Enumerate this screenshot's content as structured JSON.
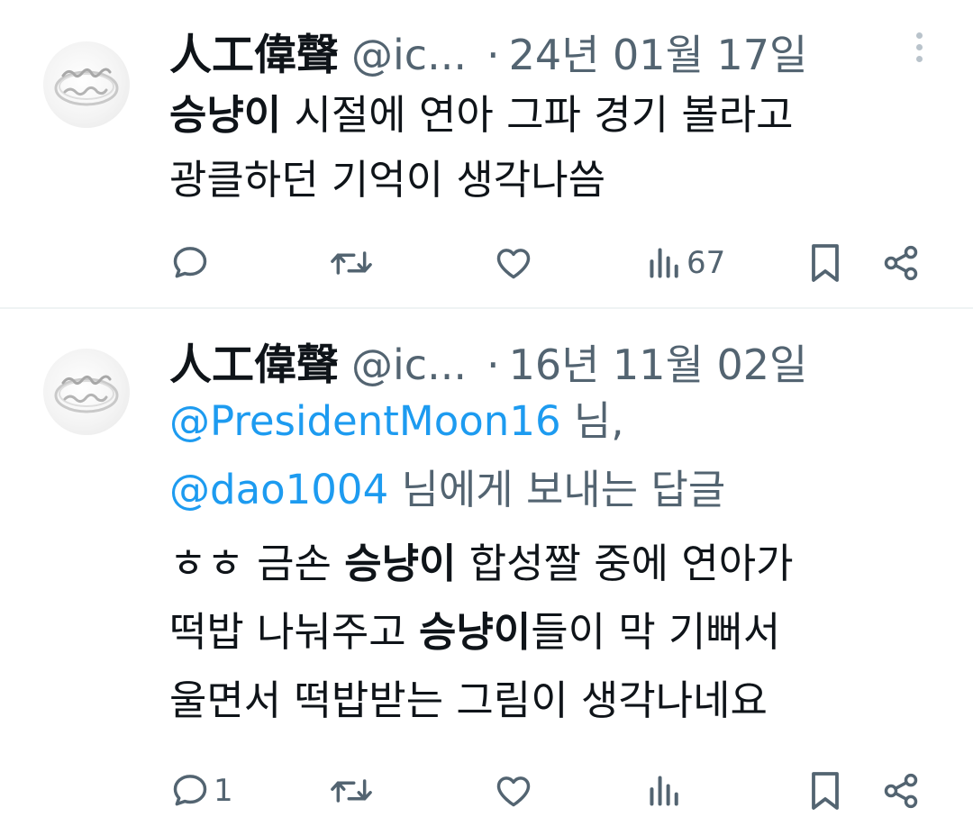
{
  "tweets": [
    {
      "author": {
        "name": "人工偉聲",
        "handle": "@ic..."
      },
      "separator": "·",
      "date": "24년 01월 17일",
      "text": {
        "bold_1": "승냥이",
        "line_1_rest": " 시절에 연아 그파 경기 볼라고",
        "line_2": "광클하던 기억이 생각나씀"
      },
      "actions": {
        "reply_icon": "comment-icon",
        "retweet_icon": "retweet-icon",
        "like_icon": "heart-icon",
        "views_icon": "bar-chart-icon",
        "views_count": "67",
        "bookmark_icon": "bookmark-icon",
        "share_icon": "share-icon"
      }
    },
    {
      "author": {
        "name": "人工偉聲",
        "handle": "@ic..."
      },
      "separator": "·",
      "date": "16년 11월 02일",
      "reply_to": {
        "mention_1": "@PresidentMoon16",
        "suffix_1": " 님,",
        "mention_2": "@dao1004",
        "suffix_2": " 님에게 보내는 답글"
      },
      "text": {
        "l1_a": "ㅎㅎ 금손 ",
        "l1_b": "승냥이",
        "l1_c": " 합성짤 중에 연아가",
        "l2_a": "떡밥 나눠주고 ",
        "l2_b": "승냥이",
        "l2_c": "들이 막 기뻐서",
        "l3": "울면서 떡밥받는 그림이 생각나네요"
      },
      "actions": {
        "reply_icon": "comment-icon",
        "reply_count": "1",
        "retweet_icon": "retweet-icon",
        "like_icon": "heart-icon",
        "views_icon": "bar-chart-icon",
        "bookmark_icon": "bookmark-icon",
        "share_icon": "share-icon"
      }
    }
  ],
  "colors": {
    "text_primary": "#0f1419",
    "text_secondary": "#536471",
    "mention": "#1d9bf0",
    "divider": "#eff3f4"
  }
}
